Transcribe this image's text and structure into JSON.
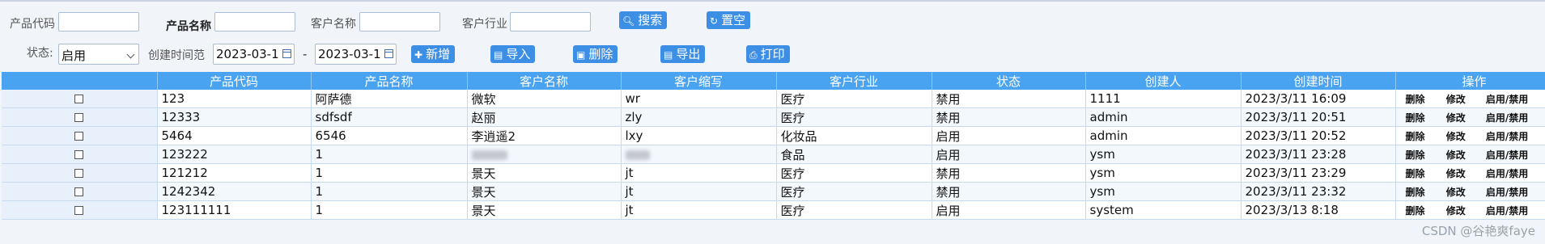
{
  "filters": {
    "product_code_label": "产品代码",
    "product_name_label": "产品名称",
    "customer_name_label": "客户名称",
    "customer_industry_label": "客户行业",
    "status_label": "状态:",
    "status_value": "启用",
    "created_range_label": "创建时间范",
    "date_from": "2023-03-1",
    "date_to": "2023-03-1",
    "date_separator": "-"
  },
  "toolbar": {
    "search": "搜索",
    "reset": "置空",
    "add": "新增",
    "import": "导入",
    "delete": "删除",
    "export": "导出",
    "print": "打印"
  },
  "table": {
    "columns": [
      "",
      "产品代码",
      "产品名称",
      "客户名称",
      "客户缩写",
      "客户行业",
      "状态",
      "创建人",
      "创建时间",
      "操作"
    ],
    "op_labels": {
      "delete": "删除",
      "edit": "修改",
      "toggle": "启用/禁用"
    },
    "rows": [
      {
        "code": "123",
        "name": "阿萨德",
        "customer": "微软",
        "abbr": "wr",
        "industry": "医疗",
        "status": "禁用",
        "creator": "1111",
        "created": "2023/3/11 16:09"
      },
      {
        "code": "12333",
        "name": "sdfsdf",
        "customer": "赵丽",
        "abbr": "zly",
        "industry": "医疗",
        "status": "禁用",
        "creator": "admin",
        "created": "2023/3/11 20:51"
      },
      {
        "code": "5464",
        "name": "6546",
        "customer": "李逍遥2",
        "abbr": "lxy",
        "industry": "化妆品",
        "status": "启用",
        "creator": "admin",
        "created": "2023/3/11 20:52"
      },
      {
        "code": "123222",
        "name": "1",
        "customer": "",
        "abbr": "",
        "industry": "食品",
        "status": "启用",
        "creator": "ysm",
        "created": "2023/3/11 23:28"
      },
      {
        "code": "121212",
        "name": "1",
        "customer": "景天",
        "abbr": "jt",
        "industry": "医疗",
        "status": "禁用",
        "creator": "ysm",
        "created": "2023/3/11 23:29"
      },
      {
        "code": "1242342",
        "name": "1",
        "customer": "景天",
        "abbr": "jt",
        "industry": "医疗",
        "status": "禁用",
        "creator": "ysm",
        "created": "2023/3/11 23:32"
      },
      {
        "code": "123111111",
        "name": "1",
        "customer": "景天",
        "abbr": "jt",
        "industry": "医疗",
        "status": "启用",
        "creator": "system",
        "created": "2023/3/13 8:18"
      }
    ]
  },
  "watermark": "CSDN @谷艳爽faye"
}
